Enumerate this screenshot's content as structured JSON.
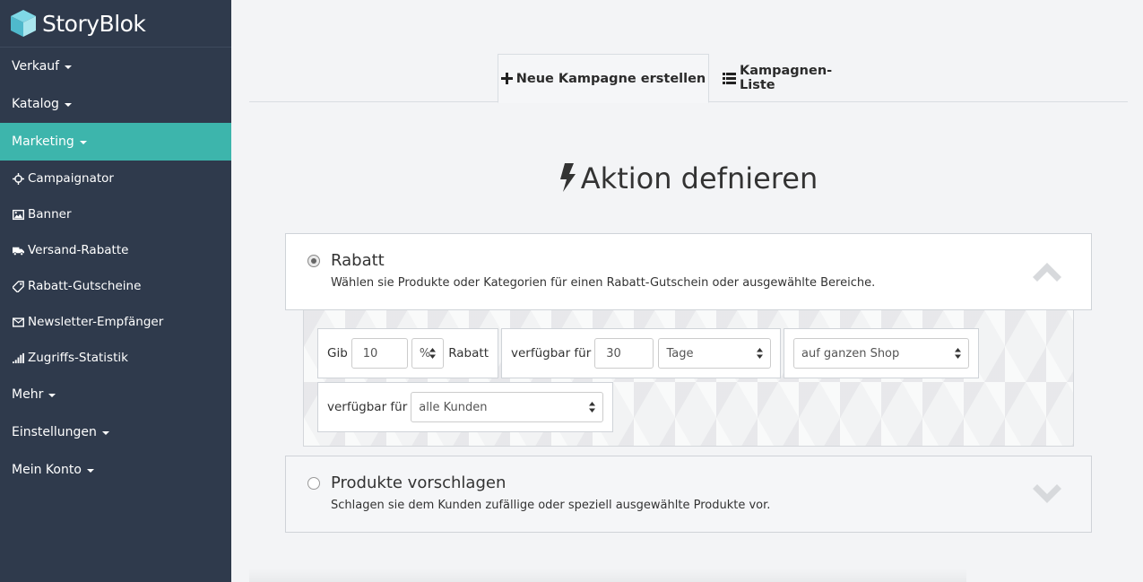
{
  "brand": {
    "name": "StoryBlok",
    "logo_icon": "cube-icon"
  },
  "sidebar": {
    "top_items": [
      {
        "label": "Verkauf"
      },
      {
        "label": "Katalog"
      },
      {
        "label": "Marketing",
        "active": true
      }
    ],
    "sub_items": [
      {
        "label": "Campaignator",
        "icon": "crosshair-icon"
      },
      {
        "label": "Banner",
        "icon": "image-icon"
      },
      {
        "label": "Versand-Rabatte",
        "icon": "truck-icon"
      },
      {
        "label": "Rabatt-Gutscheine",
        "icon": "tag-icon"
      },
      {
        "label": "Newsletter-Empfänger",
        "icon": "envelope-icon"
      },
      {
        "label": "Zugriffs-Statistik",
        "icon": "signal-icon"
      }
    ],
    "bottom_items": [
      {
        "label": "Mehr"
      },
      {
        "label": "Einstellungen"
      },
      {
        "label": "Mein Konto"
      }
    ],
    "active_color": "#3db5ac",
    "bg_color": "#2f3a4c"
  },
  "tabs": [
    {
      "label": "Neue Kampagne erstellen",
      "icon": "plus-icon",
      "active": true
    },
    {
      "label": "Kampagnen-Liste",
      "icon": "list-icon",
      "active": false
    }
  ],
  "heading": {
    "text": "Aktion defnieren",
    "icon": "bolt-icon"
  },
  "panels": {
    "rabatt": {
      "title": "Rabatt",
      "description": "Wählen sie Produkte oder Kategorien für einen Rabatt-Gutschein oder ausgewählte Bereiche.",
      "selected": true,
      "chevron": "chevron-up-icon"
    },
    "produkte": {
      "title": "Produkte vorschlagen",
      "description": "Schlagen sie dem Kunden zufällige oder speziell ausgewählte Produkte vor.",
      "selected": false,
      "chevron": "chevron-down-icon"
    }
  },
  "options": {
    "discount": {
      "prefix": "Gib",
      "value": "10",
      "unit": "%",
      "suffix": "Rabatt"
    },
    "duration": {
      "label": "verfügbar für",
      "value": "30",
      "unit": "Tage"
    },
    "scope": {
      "value": "auf ganzen Shop"
    },
    "audience": {
      "label": "verfügbar für",
      "value": "alle Kunden"
    }
  }
}
